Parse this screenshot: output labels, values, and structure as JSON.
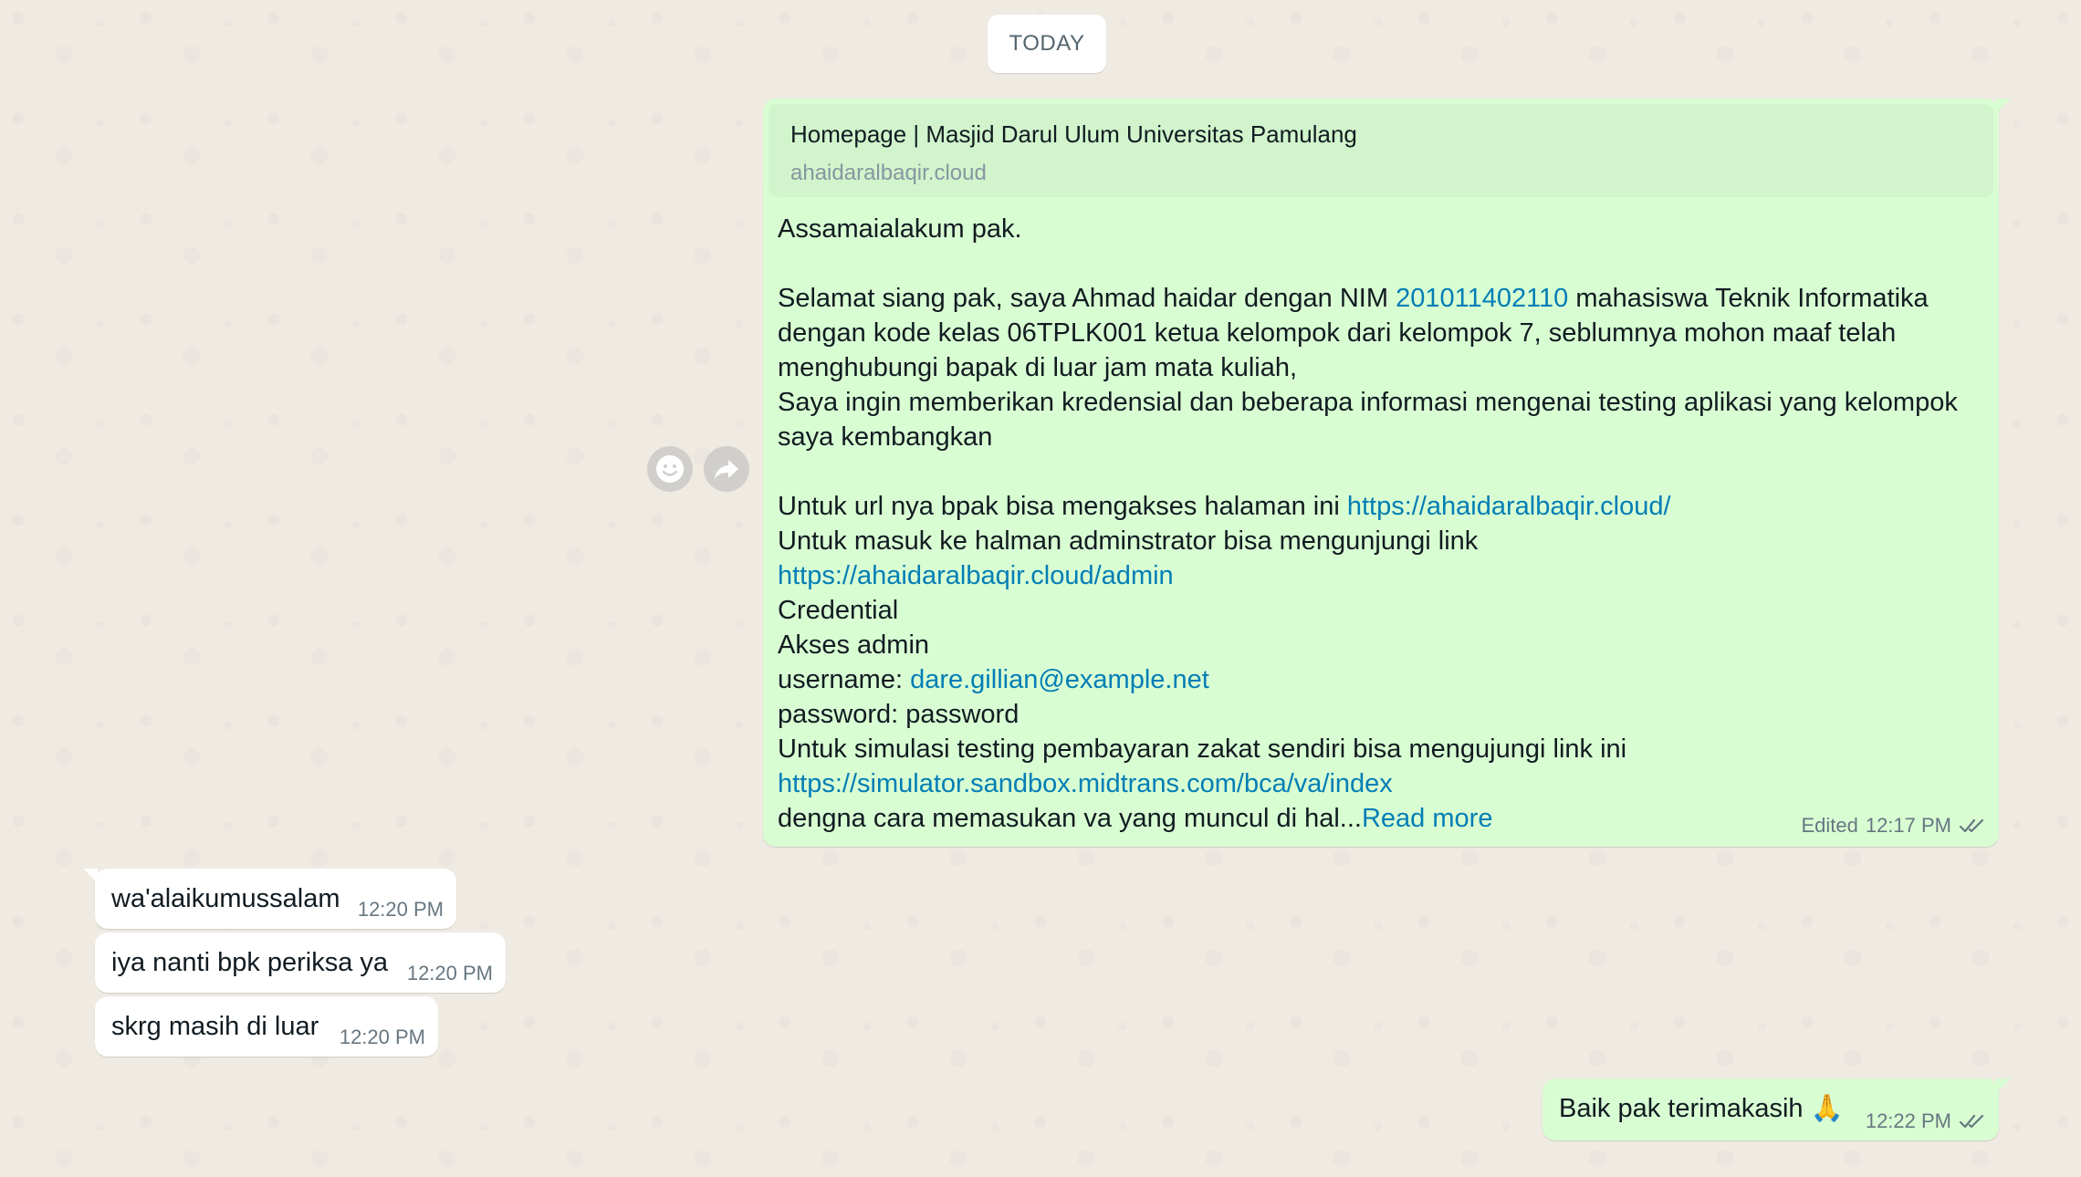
{
  "date_separator": "TODAY",
  "main_message": {
    "link_preview": {
      "title": "Homepage | Masjid Darul Ulum Universitas Pamulang",
      "domain": "ahaidaralbaqir.cloud"
    },
    "greeting": "Assamaialakum  pak.",
    "line_intro_a": "Selamat siang pak, saya Ahmad haidar dengan NIM ",
    "nim": "201011402110",
    "line_intro_b": " mahasiswa Teknik Informatika",
    "line_2": "dengan kode kelas 06TPLK001 ketua kelompok dari kelompok 7, seblumnya mohon maaf telah",
    "line_3": "menghubungi bapak di luar jam mata kuliah,",
    "line_4": "Saya ingin memberikan kredensial dan beberapa informasi mengenai testing aplikasi yang kelompok",
    "line_5": "saya kembangkan",
    "url_line_prefix": "Untuk url nya bpak bisa mengakses halaman ini ",
    "url_home": "https://ahaidaralbaqir.cloud/",
    "admin_line": "Untuk masuk ke halman adminstrator bisa mengunjungi link",
    "url_admin": "https://ahaidaralbaqir.cloud/admin",
    "credential_label": "Credential",
    "admin_access_label": "Akses admin",
    "username_label": "username: ",
    "username_value": "dare.gillian@example.net",
    "password_line": "password: password",
    "simulation_line": "Untuk simulasi testing pembayaran zakat sendiri  bisa mengujungi link ini",
    "url_sim": "https://simulator.sandbox.midtrans.com/bca/va/index",
    "truncated_line": "dengna cara memasukan va yang muncul di hal...",
    "read_more": "Read more",
    "edited_label": "Edited",
    "time": "12:17 PM"
  },
  "incoming_messages": [
    {
      "text": "wa'alaikumussalam",
      "time": "12:20 PM"
    },
    {
      "text": "iya nanti bpk periksa ya",
      "time": "12:20 PM"
    },
    {
      "text": "skrg masih di luar",
      "time": "12:20 PM"
    }
  ],
  "last_message": {
    "text": "Baik pak terimakasih 🙏",
    "time": "12:22 PM"
  },
  "colors": {
    "background": "#efeae2",
    "outgoing_bubble": "#d9fdd3",
    "incoming_bubble": "#ffffff",
    "link": "#027eb5",
    "read_receipt": "#667781"
  },
  "icons": {
    "react": "smiley-icon",
    "forward": "forward-icon",
    "read_receipt": "double-check-icon"
  }
}
